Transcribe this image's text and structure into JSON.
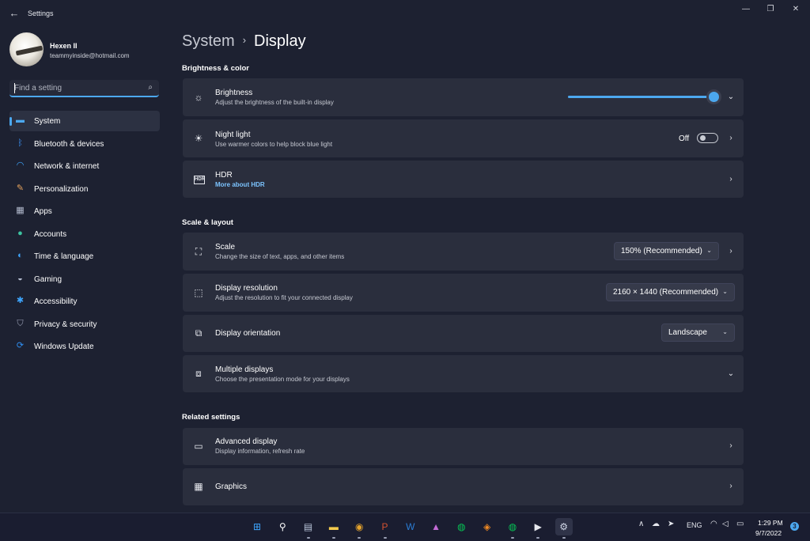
{
  "window": {
    "title": "Settings",
    "controls": [
      "—",
      "❐",
      "✕"
    ]
  },
  "profile": {
    "name": "Hexen II",
    "email": "teammyinside@hotmail.com"
  },
  "search": {
    "placeholder": "Find a setting"
  },
  "nav": {
    "items": [
      {
        "label": "System",
        "icon": "monitor-icon",
        "color": "#4ca8ef",
        "active": true
      },
      {
        "label": "Bluetooth & devices",
        "icon": "bluetooth-icon",
        "color": "#3a8ff0"
      },
      {
        "label": "Network & internet",
        "icon": "wifi-icon",
        "color": "#3ea6ff"
      },
      {
        "label": "Personalization",
        "icon": "brush-icon",
        "color": "#e8a45d"
      },
      {
        "label": "Apps",
        "icon": "apps-icon",
        "color": "#b4bccf"
      },
      {
        "label": "Accounts",
        "icon": "person-icon",
        "color": "#3dc2a0"
      },
      {
        "label": "Time & language",
        "icon": "globe-clock-icon",
        "color": "#3ea6ff"
      },
      {
        "label": "Gaming",
        "icon": "controller-icon",
        "color": "#b4bccf"
      },
      {
        "label": "Accessibility",
        "icon": "accessibility-icon",
        "color": "#3ea6ff"
      },
      {
        "label": "Privacy & security",
        "icon": "shield-icon",
        "color": "#9aa0b5"
      },
      {
        "label": "Windows Update",
        "icon": "sync-icon",
        "color": "#2f8ff2"
      }
    ]
  },
  "breadcrumb": {
    "parent": "System",
    "separator": "›",
    "current": "Display"
  },
  "sections": {
    "brightness_color": "Brightness & color",
    "scale_layout": "Scale & layout",
    "related": "Related settings"
  },
  "brightness": {
    "title": "Brightness",
    "subtitle": "Adjust the brightness of the built-in display",
    "level_percent": 97
  },
  "night_light": {
    "title": "Night light",
    "subtitle": "Use warmer colors to help block blue light",
    "state": "Off"
  },
  "hdr": {
    "title": "HDR",
    "link": "More about HDR",
    "badge": "HDR"
  },
  "scale": {
    "title": "Scale",
    "subtitle": "Change the size of text, apps, and other items",
    "value": "150% (Recommended)"
  },
  "resolution": {
    "title": "Display resolution",
    "subtitle": "Adjust the resolution to fit your connected display",
    "value": "2160 × 1440 (Recommended)"
  },
  "orientation": {
    "title": "Display orientation",
    "value": "Landscape"
  },
  "multiple": {
    "title": "Multiple displays",
    "subtitle": "Choose the presentation mode for your displays"
  },
  "advanced": {
    "title": "Advanced display",
    "subtitle": "Display information, refresh rate"
  },
  "graphics": {
    "title": "Graphics"
  },
  "taskbar": {
    "apps": [
      {
        "name": "start-icon",
        "glyph": "⊞",
        "color": "#3ea6ff"
      },
      {
        "name": "search-icon",
        "glyph": "⚲",
        "color": "#ffffff"
      },
      {
        "name": "notepad-icon",
        "glyph": "▤",
        "color": "#b8c4d8",
        "dot": true
      },
      {
        "name": "file-explorer-icon",
        "glyph": "▬",
        "color": "#f2c94c",
        "dot": true
      },
      {
        "name": "chrome-icon",
        "glyph": "◉",
        "color": "#e3a22d",
        "dot": true
      },
      {
        "name": "powerpoint-icon",
        "glyph": "P",
        "color": "#d35230",
        "dot": true
      },
      {
        "name": "word-icon",
        "glyph": "W",
        "color": "#2b7cd3"
      },
      {
        "name": "affinity-icon",
        "glyph": "▲",
        "color": "#c36bd6"
      },
      {
        "name": "line-icon",
        "glyph": "◍",
        "color": "#06c755"
      },
      {
        "name": "app-orange-icon",
        "glyph": "◈",
        "color": "#f08a24"
      },
      {
        "name": "line-active-icon",
        "glyph": "◍",
        "color": "#06c755",
        "dot": true
      },
      {
        "name": "media-player-icon",
        "glyph": "▶",
        "color": "#e6e8ee",
        "dot": true
      },
      {
        "name": "settings-icon",
        "glyph": "⚙",
        "color": "#cfd6e6",
        "dot": true,
        "active": true
      }
    ],
    "tray": {
      "language": "ENG",
      "time": "1:29 PM",
      "date": "9/7/2022",
      "notifications": "3"
    }
  }
}
